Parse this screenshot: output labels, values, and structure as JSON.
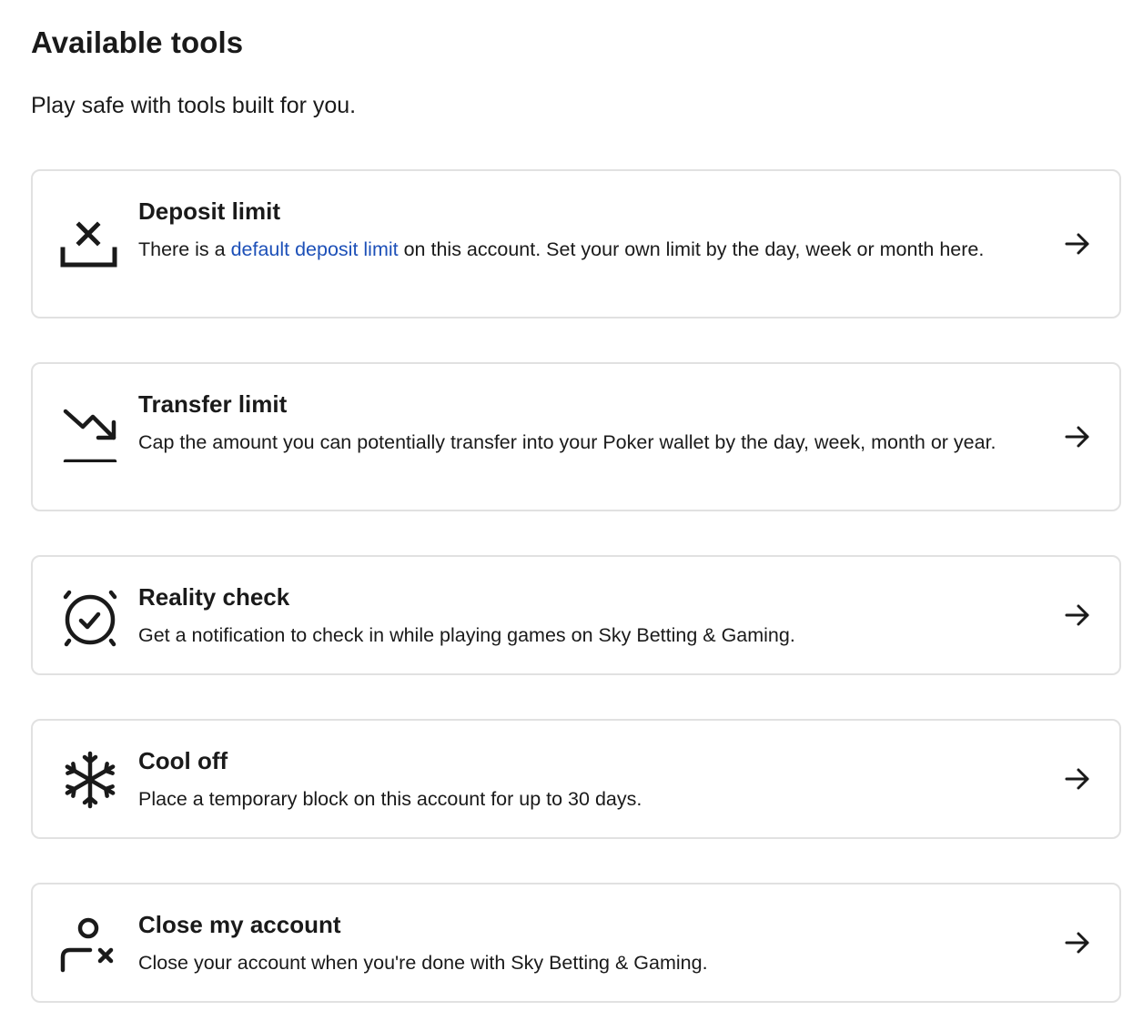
{
  "header": {
    "title": "Available tools",
    "subtitle": "Play safe with tools built for you."
  },
  "tools": [
    {
      "title": "Deposit limit",
      "desc_before": "There is a ",
      "desc_link": "default deposit limit",
      "desc_after": " on this account. Set your own limit by the day, week or month here.",
      "icon": "deposit-limit-icon"
    },
    {
      "title": "Transfer limit",
      "desc": "Cap the amount you can potentially transfer into your Poker wallet by the day, week, month or year.",
      "icon": "trend-down-icon"
    },
    {
      "title": "Reality check",
      "desc": "Get a notification to check in while playing games on Sky Betting & Gaming.",
      "icon": "alarm-clock-check-icon"
    },
    {
      "title": "Cool off",
      "desc": "Place a temporary block on this account for up to 30 days.",
      "icon": "snowflake-icon"
    },
    {
      "title": "Close my account",
      "desc": "Close your account when you're done with Sky Betting & Gaming.",
      "icon": "user-remove-icon"
    }
  ],
  "colors": {
    "link": "#1d50b8",
    "text": "#1a1a1a",
    "border": "#e1e1e1"
  },
  "arrow_icon": "arrow-right-icon"
}
